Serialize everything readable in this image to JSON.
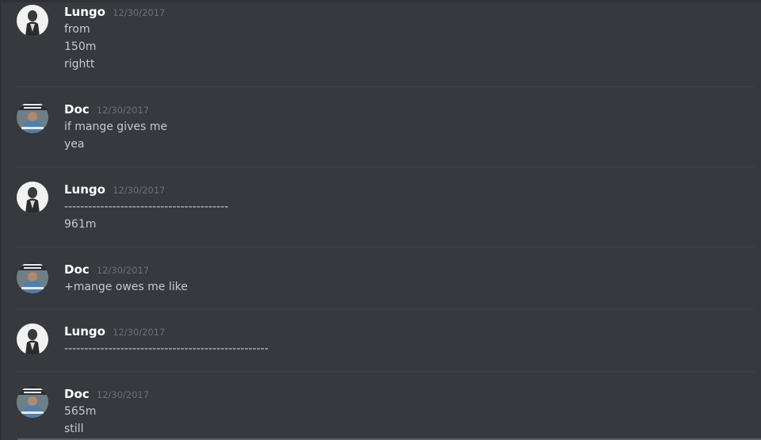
{
  "messages": [
    {
      "author": "Lungo",
      "timestamp": "12/30/2017",
      "avatar_icon": "lungo-avatar-icon",
      "lines": [
        "from",
        "150m",
        "rightt"
      ]
    },
    {
      "author": "Doc",
      "timestamp": "12/30/2017",
      "avatar_icon": "doc-avatar-icon",
      "lines": [
        "if mange gives me",
        "yea"
      ]
    },
    {
      "author": "Lungo",
      "timestamp": "12/30/2017",
      "avatar_icon": "lungo-avatar-icon",
      "lines": [
        "-----------------------------------------",
        "961m"
      ]
    },
    {
      "author": "Doc",
      "timestamp": "12/30/2017",
      "avatar_icon": "doc-avatar-icon",
      "lines": [
        "+mange owes me like"
      ]
    },
    {
      "author": "Lungo",
      "timestamp": "12/30/2017",
      "avatar_icon": "lungo-avatar-icon",
      "lines": [
        "---------------------------------------------------"
      ]
    },
    {
      "author": "Doc",
      "timestamp": "12/30/2017",
      "avatar_icon": "doc-avatar-icon",
      "lines": [
        "565m",
        "still"
      ]
    }
  ],
  "colors": {
    "background": "#36393e",
    "username": "#ffffff",
    "timestamp": "#6d6f73",
    "message_text": "#c7c9cb",
    "divider": "#3f4247"
  }
}
